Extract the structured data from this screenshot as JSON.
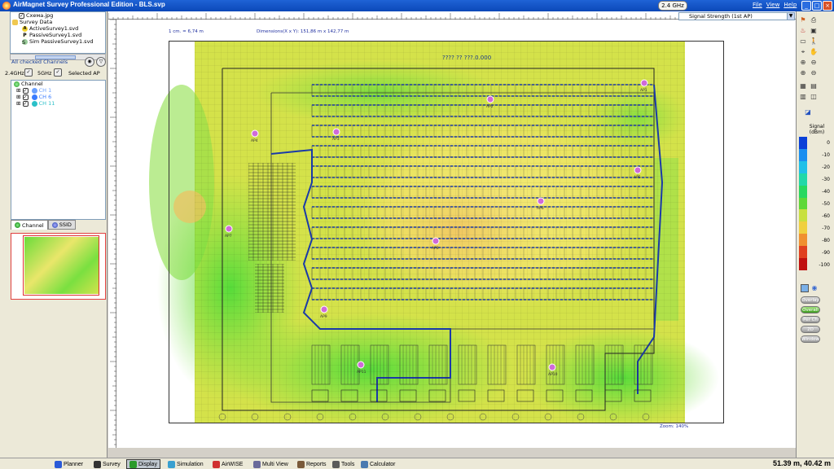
{
  "window": {
    "title": "AirMagnet Survey Professional Edition - BLS.svp",
    "band_button": "2.4 GHz",
    "menu": [
      "File",
      "View",
      "Help"
    ],
    "buttons": {
      "minimize": "_",
      "maximize": "□",
      "close": "×"
    }
  },
  "tree": {
    "items": [
      {
        "label": "Схема.jpg",
        "icon": "checkbox-icon"
      },
      {
        "label": "Survey Data",
        "icon": "folder-icon"
      },
      {
        "label": "ActiveSurvey1.svd",
        "icon": "active-survey-icon",
        "glyph": "A"
      },
      {
        "label": "PassiveSurvey1.svd",
        "icon": "passive-survey-icon",
        "glyph": "P"
      },
      {
        "label": "Sim PassiveSurvey1.svd",
        "icon": "sim-survey-icon",
        "glyph": "S"
      }
    ]
  },
  "channels_panel": {
    "header": "All checked Channels",
    "band_24": "2.4GHz",
    "band_5": "5GHz",
    "selected_ap": "Selected AP",
    "root": "Channel",
    "channels": [
      {
        "label": "CH 1",
        "color": "#6aa0ff"
      },
      {
        "label": "CH 6",
        "color": "#3a7cff"
      },
      {
        "label": "CH 11",
        "color": "#2bc0c8"
      }
    ]
  },
  "tabs": [
    {
      "label": "Channel",
      "active": true
    },
    {
      "label": "SSID",
      "active": false
    }
  ],
  "map": {
    "scale_note": "1 cm. = 6,74 m",
    "dimensions_note": "Dimensions(X x Y): 151,86 m x 142,77 m",
    "zoom_note": "Zoom: 140%",
    "map_title": "????  ??  ???.0.000"
  },
  "right_panel": {
    "dropdown_value": "Signal Strength (1st AP)",
    "legend_title": "Signal\n(dBm)",
    "legend": {
      "labels": [
        "0",
        "-10",
        "-20",
        "-30",
        "-40",
        "-50",
        "-60",
        "-70",
        "-80",
        "-90",
        "-100"
      ],
      "colors": [
        "#0a40d8",
        "#1a8ef0",
        "#20c0e8",
        "#22d8a8",
        "#28d860",
        "#5ed838",
        "#c8e040",
        "#f0d040",
        "#f09030",
        "#e04020",
        "#c01010"
      ]
    },
    "pills": [
      "Overlay",
      "Overall",
      "Per Ch",
      "2D",
      "Window"
    ]
  },
  "bottom_tabs": [
    {
      "label": "Planner",
      "icon": "planner-icon",
      "color": "#2a5ad8"
    },
    {
      "label": "Survey",
      "icon": "survey-icon",
      "color": "#333"
    },
    {
      "label": "Display",
      "icon": "display-icon",
      "color": "#2a9a2a",
      "active": true
    },
    {
      "label": "Simulation",
      "icon": "simulation-icon",
      "color": "#3aa0d0"
    },
    {
      "label": "AirWISE",
      "icon": "airwise-icon",
      "color": "#d03030"
    },
    {
      "label": "Multi View",
      "icon": "multi-view-icon",
      "color": "#6a6a9a"
    },
    {
      "label": "Reports",
      "icon": "reports-icon",
      "color": "#7a5a3a"
    },
    {
      "label": "Tools",
      "icon": "tools-icon",
      "color": "#5a5a5a"
    },
    {
      "label": "Calculator",
      "icon": "calculator-icon",
      "color": "#4a7ab0"
    }
  ],
  "status": {
    "coords": "51.39 m, 40.42 m"
  },
  "access_points": [
    {
      "label": "AP1"
    },
    {
      "label": "AP2"
    },
    {
      "label": "AP3"
    },
    {
      "label": "AP4"
    },
    {
      "label": "AP5"
    },
    {
      "label": "AP6"
    },
    {
      "label": "AP7"
    },
    {
      "label": "AP8"
    },
    {
      "label": "AP9"
    },
    {
      "label": "AP10"
    },
    {
      "label": "AP11"
    }
  ]
}
